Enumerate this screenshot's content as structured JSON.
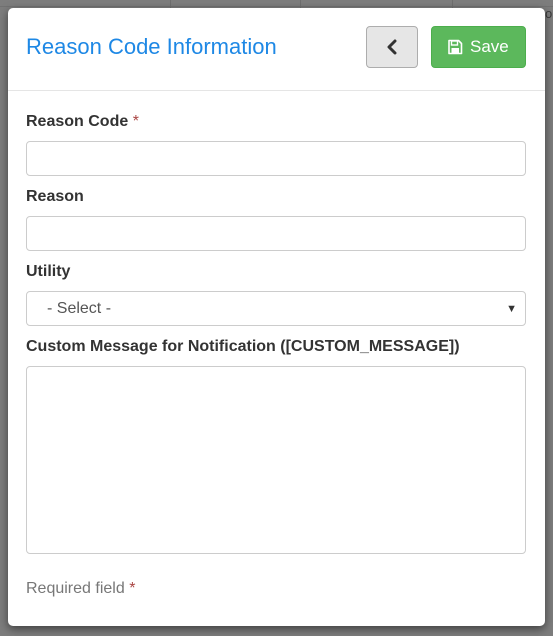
{
  "modal": {
    "title": "Reason Code Information",
    "back_icon": "chevron-left-icon",
    "save_icon": "floppy-disk-icon",
    "save_label": "Save",
    "colors": {
      "title": "#1e88e5",
      "save_button": "#5cb85c",
      "required_star": "#a94442"
    }
  },
  "form": {
    "reason_code": {
      "label": "Reason Code",
      "required_marker": "*",
      "value": ""
    },
    "reason": {
      "label": "Reason",
      "value": ""
    },
    "utility": {
      "label": "Utility",
      "selected": "- Select -",
      "caret": "▼"
    },
    "custom_message": {
      "label": "Custom Message for Notification ([CUSTOM_MESSAGE])",
      "value": ""
    },
    "required_note": {
      "text": "Required field",
      "marker": "*"
    }
  },
  "background": {
    "glyph": "o"
  }
}
